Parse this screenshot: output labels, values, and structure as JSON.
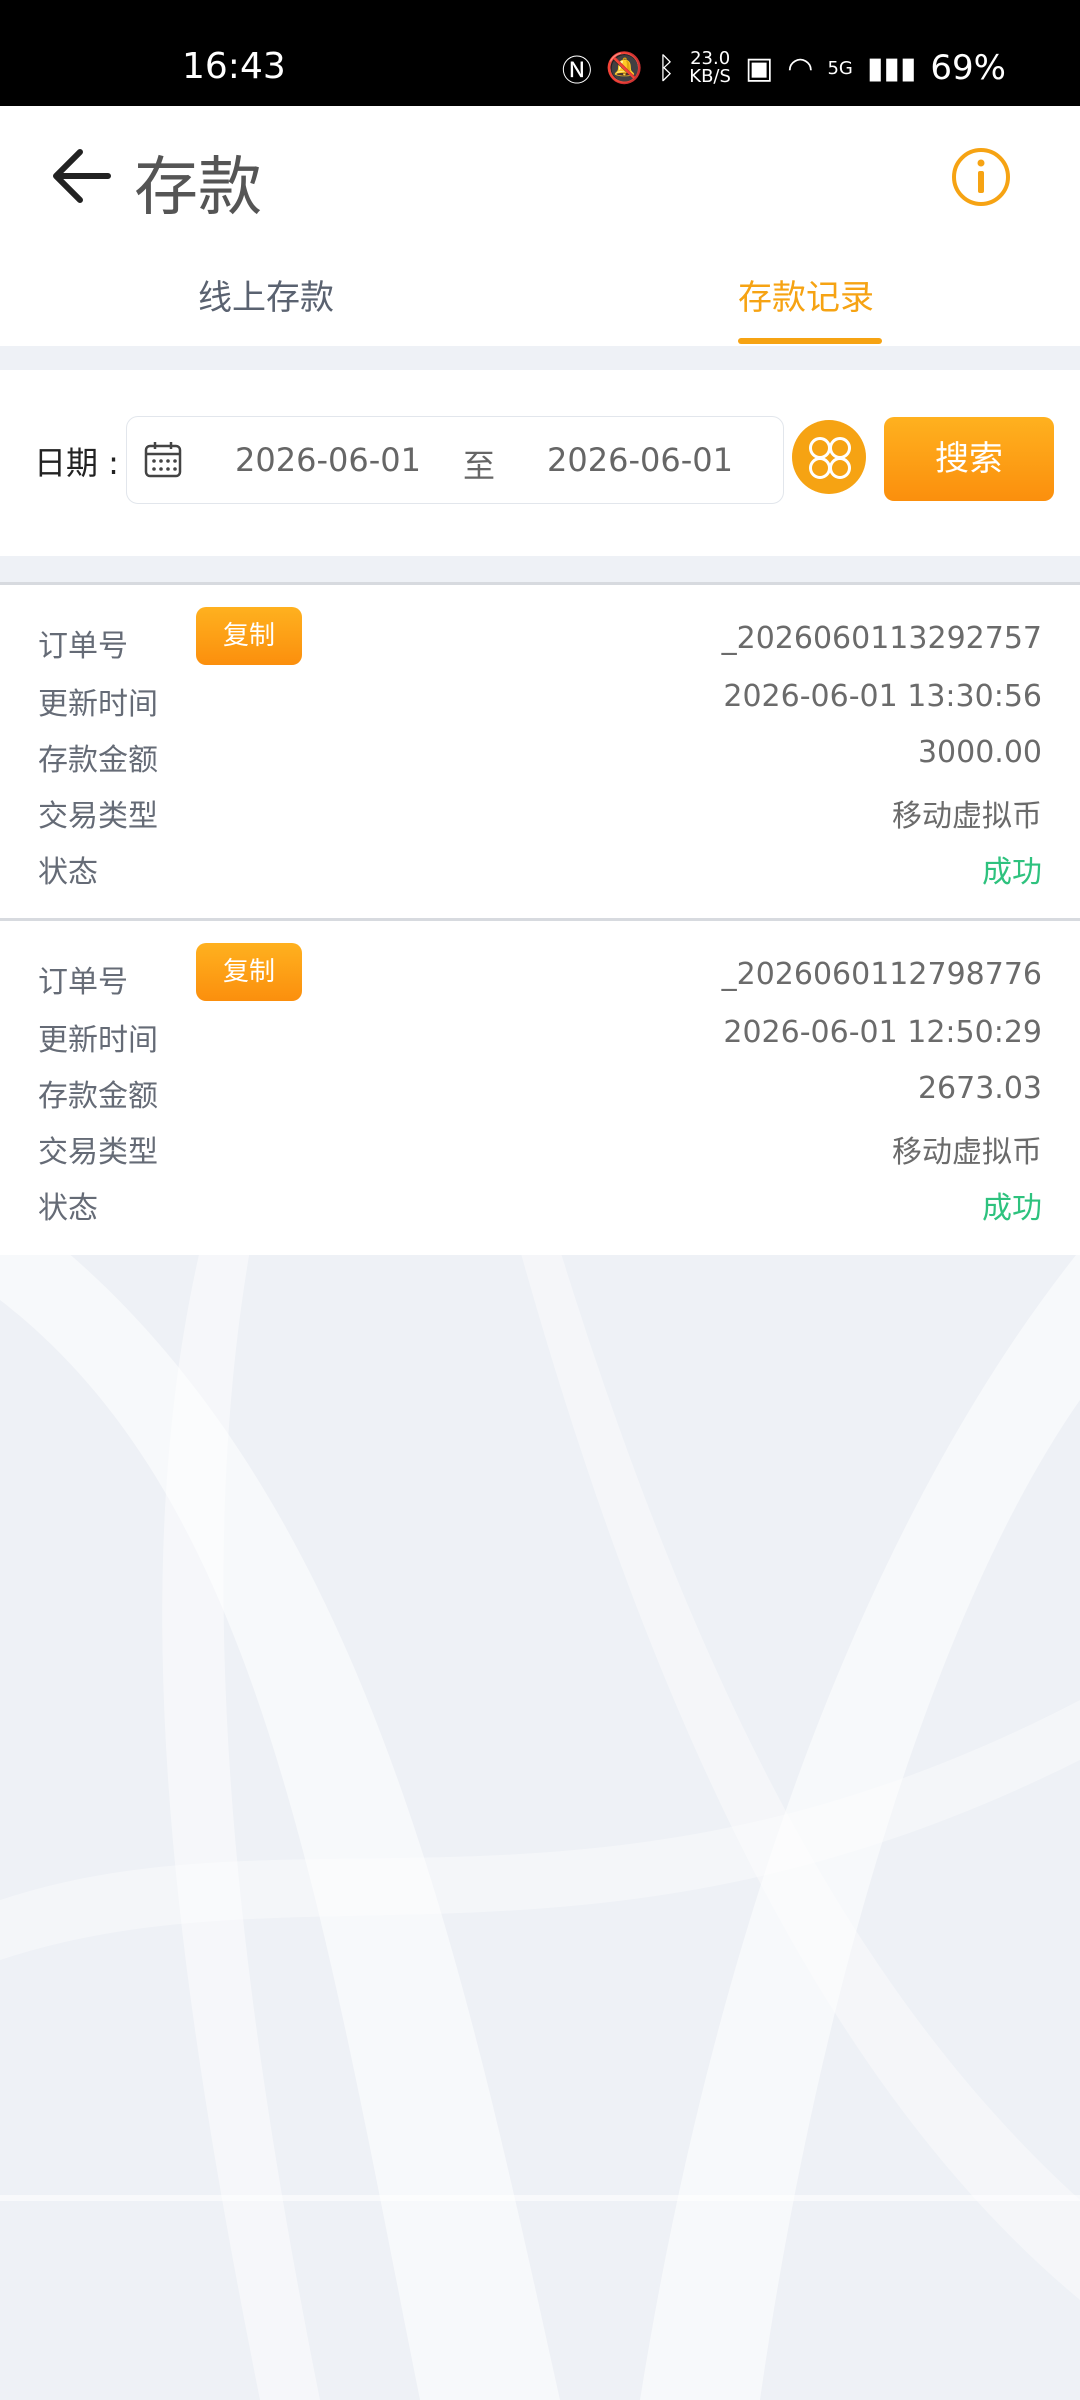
{
  "status_bar": {
    "time": "16:43",
    "net_speed_value": "23.0",
    "net_speed_unit": "KB/S",
    "network": "5G",
    "battery": "69%"
  },
  "header": {
    "title": "存款",
    "back_icon": "back-arrow-icon",
    "info_icon": "info-icon"
  },
  "tabs": [
    {
      "label": "线上存款",
      "active": false
    },
    {
      "label": "存款记录",
      "active": true
    }
  ],
  "filter": {
    "date_label": "日期 :",
    "from": "2026-06-01",
    "to_separator": "至",
    "to": "2026-06-01",
    "search_label": "搜索"
  },
  "records": [
    {
      "order_label": "订单号",
      "copy_label": "复制",
      "order_no": "_2026060113292757",
      "time_label": "更新时间",
      "time": "2026-06-01 13:30:56",
      "amount_label": "存款金额",
      "amount": "3000.00",
      "type_label": "交易类型",
      "type": "移动虚拟币",
      "status_label": "状态",
      "status": "成功"
    },
    {
      "order_label": "订单号",
      "copy_label": "复制",
      "order_no": "_2026060112798776",
      "time_label": "更新时间",
      "time": "2026-06-01 12:50:29",
      "amount_label": "存款金额",
      "amount": "2673.03",
      "type_label": "交易类型",
      "type": "移动虚拟币",
      "status_label": "状态",
      "status": "成功"
    }
  ],
  "colors": {
    "accent": "#f6a313",
    "success": "#2ec27e",
    "background": "#eef1f6"
  }
}
